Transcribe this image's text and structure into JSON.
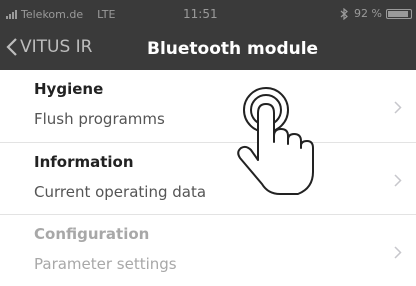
{
  "status_bar": {
    "carrier": "Telekom.de",
    "network": "LTE",
    "time": "11:51",
    "bluetooth_icon": "bluetooth-icon",
    "battery_text": "92 %",
    "battery_level": 0.92
  },
  "navbar": {
    "back_label": "VITUS IR",
    "title": "Bluetooth module"
  },
  "menu": [
    {
      "title": "Hygiene",
      "subtitle": "Flush programms",
      "enabled": true
    },
    {
      "title": "Information",
      "subtitle": "Current operating data",
      "enabled": true
    },
    {
      "title": "Configuration",
      "subtitle": "Parameter settings",
      "enabled": false
    }
  ],
  "colors": {
    "header_bg": "#3a3a3a",
    "header_title": "#ffffff",
    "status_text": "#9a9a9a",
    "disabled_text": "#a8a8a8",
    "chevron": "#c7c7cc"
  },
  "overlay": {
    "icon": "tap-hand-icon"
  }
}
